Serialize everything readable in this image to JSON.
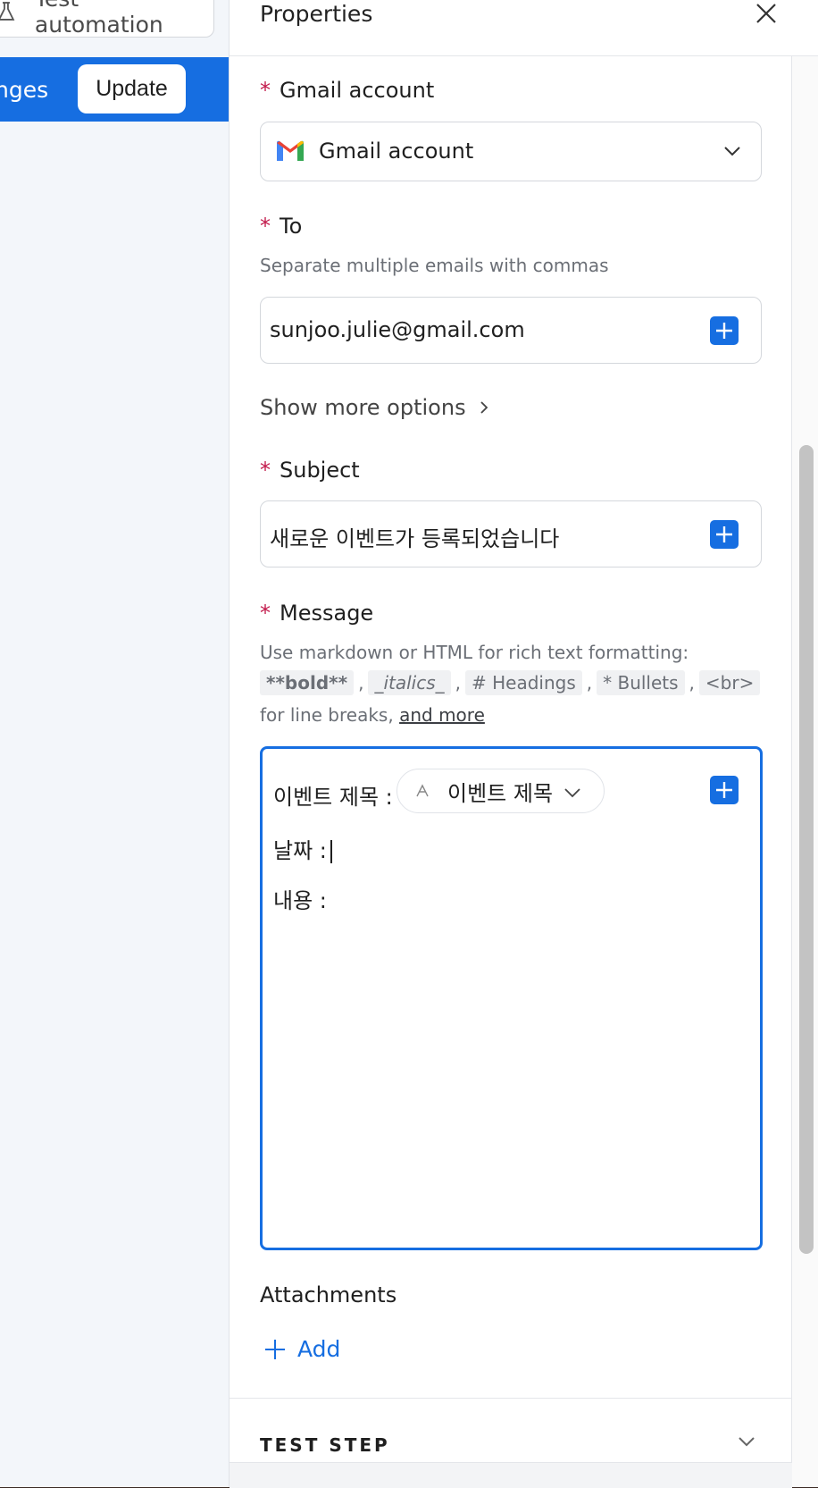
{
  "left": {
    "test_automation_label": "Test automation",
    "banner_text": "nges",
    "update_label": "Update"
  },
  "panel": {
    "title": "Properties",
    "gmail_account": {
      "label": "Gmail account",
      "value": "Gmail account"
    },
    "to": {
      "label": "To",
      "hint": "Separate multiple emails with commas",
      "value": "sunjoo.julie@gmail.com"
    },
    "show_more": "Show more options",
    "subject": {
      "label": "Subject",
      "value": "새로운 이벤트가 등록되었습니다"
    },
    "message": {
      "label": "Message",
      "hint_prefix": "Use markdown or HTML for rich text formatting:",
      "codes": [
        "**bold**",
        "_italics_",
        "# Headings",
        "* Bullets",
        "<br>"
      ],
      "separator": ",",
      "hint_suffix": "for line breaks,",
      "more_link": "and more",
      "line1": "이벤트 제목 :",
      "pill": "이벤트 제목",
      "line2": "날짜 :",
      "line3": "내용 :"
    },
    "attachments": {
      "label": "Attachments",
      "add": "Add"
    },
    "test_step": "TEST STEP"
  },
  "colors": {
    "accent": "#166ee1",
    "required": "#c21a4b"
  }
}
